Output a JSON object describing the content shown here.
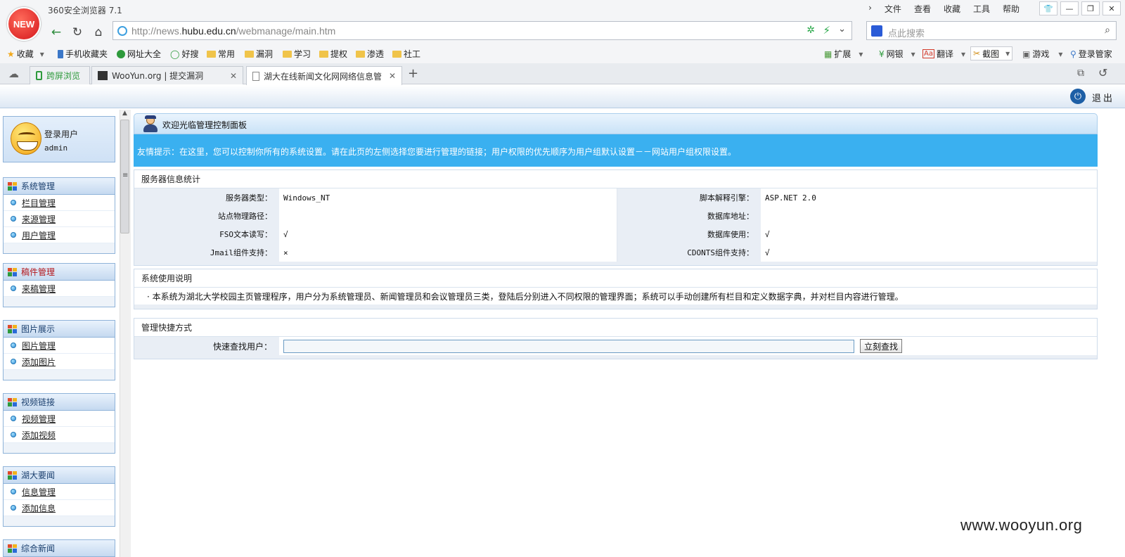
{
  "browser": {
    "title": "360安全浏览器 7.1",
    "logo_text": "NEW",
    "menu": [
      "文件",
      "查看",
      "收藏",
      "工具",
      "帮助"
    ],
    "url_prefix": "http://news.",
    "url_domain": "hubu.edu.cn",
    "url_path": "/webmanage/main.htm",
    "search_placeholder": "点此搜索"
  },
  "bookmarks": {
    "left": [
      {
        "label": "收藏",
        "icon": "star-icon"
      },
      {
        "label": "手机收藏夹",
        "icon": "phone-icon"
      },
      {
        "label": "网址大全",
        "icon": "web-icon"
      },
      {
        "label": "好搜",
        "icon": "search-icon"
      },
      {
        "label": "常用",
        "icon": "folder-icon"
      },
      {
        "label": "漏洞",
        "icon": "folder-icon"
      },
      {
        "label": "学习",
        "icon": "folder-icon"
      },
      {
        "label": "提权",
        "icon": "folder-icon"
      },
      {
        "label": "渗透",
        "icon": "folder-icon"
      },
      {
        "label": "社工",
        "icon": "folder-icon"
      }
    ],
    "right": [
      {
        "label": "扩展",
        "icon": "grid-icon"
      },
      {
        "label": "网银",
        "icon": "bank-icon"
      },
      {
        "label": "翻译",
        "icon": "translate-icon"
      },
      {
        "label": "截图",
        "icon": "scissors-icon"
      },
      {
        "label": "游戏",
        "icon": "game-icon"
      },
      {
        "label": "登录管家",
        "icon": "key-icon"
      }
    ]
  },
  "tabs": [
    {
      "label": "跨屏浏览"
    },
    {
      "label": "WooYun.org | 提交漏洞"
    },
    {
      "label": "湖大在线新闻文化网网络信息管"
    }
  ],
  "page": {
    "logout": "退出",
    "user_label": "登录用户",
    "user_name": "admin",
    "sidebar": [
      {
        "title": "系统管理",
        "red": false,
        "items": [
          "栏目管理",
          "来源管理",
          "用户管理"
        ]
      },
      {
        "title": "稿件管理",
        "red": true,
        "items": [
          "来稿管理"
        ]
      },
      {
        "title": "图片展示",
        "red": false,
        "items": [
          "图片管理",
          "添加图片"
        ]
      },
      {
        "title": "视频链接",
        "red": false,
        "items": [
          "视频管理",
          "添加视频"
        ]
      },
      {
        "title": "湖大要闻",
        "red": false,
        "items": [
          "信息管理",
          "添加信息"
        ]
      },
      {
        "title": "综合新闻",
        "red": false,
        "items": []
      }
    ],
    "welcome_title": "欢迎光临管理控制面板",
    "tip": "友情提示：在这里，您可以控制你所有的系统设置。请在此页的左侧选择您要进行管理的链接；用户权限的优先顺序为用户组默认设置－－网站用户组权限设置。",
    "server_panel": {
      "title": "服务器信息统计",
      "rows": [
        {
          "l1": "服务器类型：",
          "v1": "Windows_NT",
          "l2": "脚本解释引擎：",
          "v2": "ASP.NET 2.0"
        },
        {
          "l1": "站点物理路径：",
          "v1": "",
          "l2": "数据库地址：",
          "v2": ""
        },
        {
          "l1": "FSO文本读写：",
          "v1": "√",
          "l2": "数据库使用：",
          "v2": "√"
        },
        {
          "l1": "Jmail组件支持：",
          "v1": "×",
          "l2": "CDONTS组件支持：",
          "v2": "√"
        }
      ]
    },
    "usage_panel": {
      "title": "系统使用说明",
      "text": "· 本系统为湖北大学校园主页管理程序，用户分为系统管理员、新闻管理员和会议管理员三类，登陆后分别进入不同权限的管理界面；系统可以手动创建所有栏目和定义数据字典，并对栏目内容进行管理。"
    },
    "quick_panel": {
      "title": "管理快捷方式",
      "label": "快速查找用户：",
      "input_value": "",
      "button": "立刻查找"
    }
  },
  "watermark": "www.wooyun.org"
}
